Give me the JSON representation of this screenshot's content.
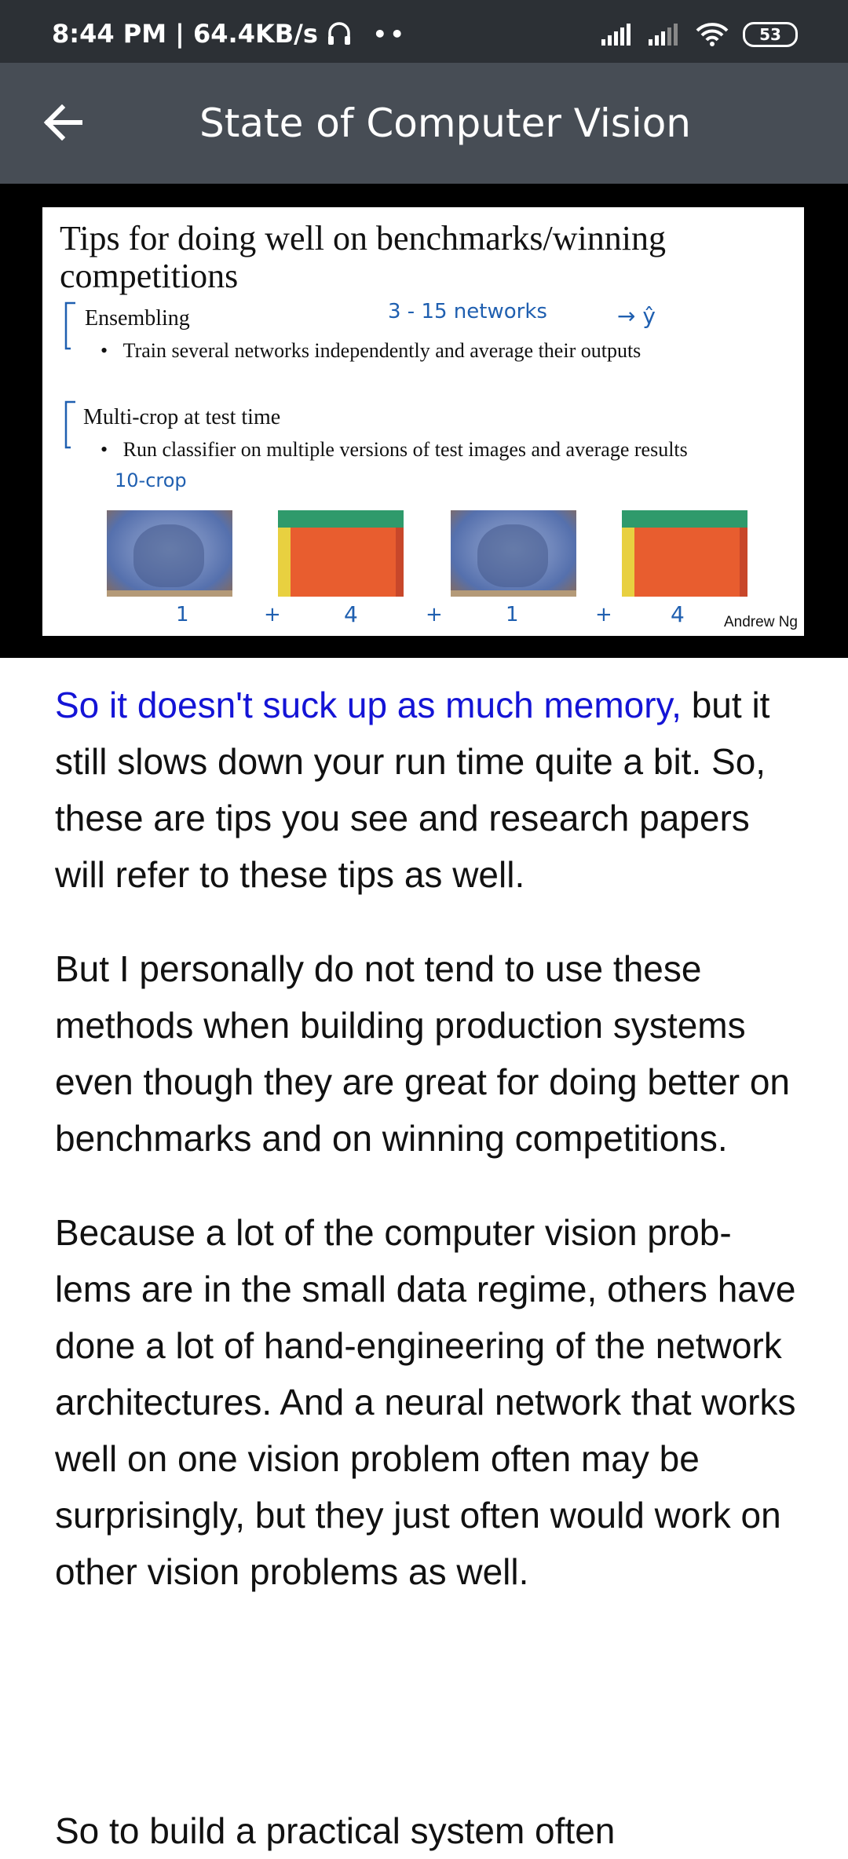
{
  "status_bar": {
    "time_speed": "8:44 PM | 64.4KB/s",
    "dots": "••",
    "battery": "53",
    "icons": [
      "headset-icon",
      "signal-icon",
      "signal-icon",
      "wifi-icon",
      "battery-icon"
    ]
  },
  "app_bar": {
    "back_icon": "arrow-left-icon",
    "title": "State of Computer Vision"
  },
  "slide": {
    "title": "Tips for doing well on benchmarks/winning competitions",
    "section1": "Ensembling",
    "bullet1": "Train several networks independently and average their outputs",
    "section2": "Multi-crop at test time",
    "bullet2": "Run classifier on multiple versions of test images and average results",
    "author": "Andrew Ng",
    "annotations": {
      "networks": "3 - 15   networks",
      "yhat": "→ ŷ",
      "ten_crop": "10-crop",
      "n1": "1",
      "plus1": "+",
      "n2": "4",
      "plus2": "+",
      "n3": "1",
      "plus3": "+",
      "n4": "4"
    }
  },
  "transcript": {
    "highlight": "So it doesn't suck up as much memory,",
    "p1_rest": "but it still slows down your run time quite a bit. So, these are tips you see and research papers will refer to these tips as well.",
    "p2": "But I personally do not tend to use these methods when building production systems even though they are great for doing better on benchmarks and on winning competitions.",
    "p3": "Because a lot of the computer vision prob-lems are in the small data regime, others have done a lot of hand-engineering of the network architectures. And a neural network that works well on one vision problem often may be surprisingly, but they just often would work on other vision problems as well.",
    "partial_line": "So to build a practical system often"
  }
}
